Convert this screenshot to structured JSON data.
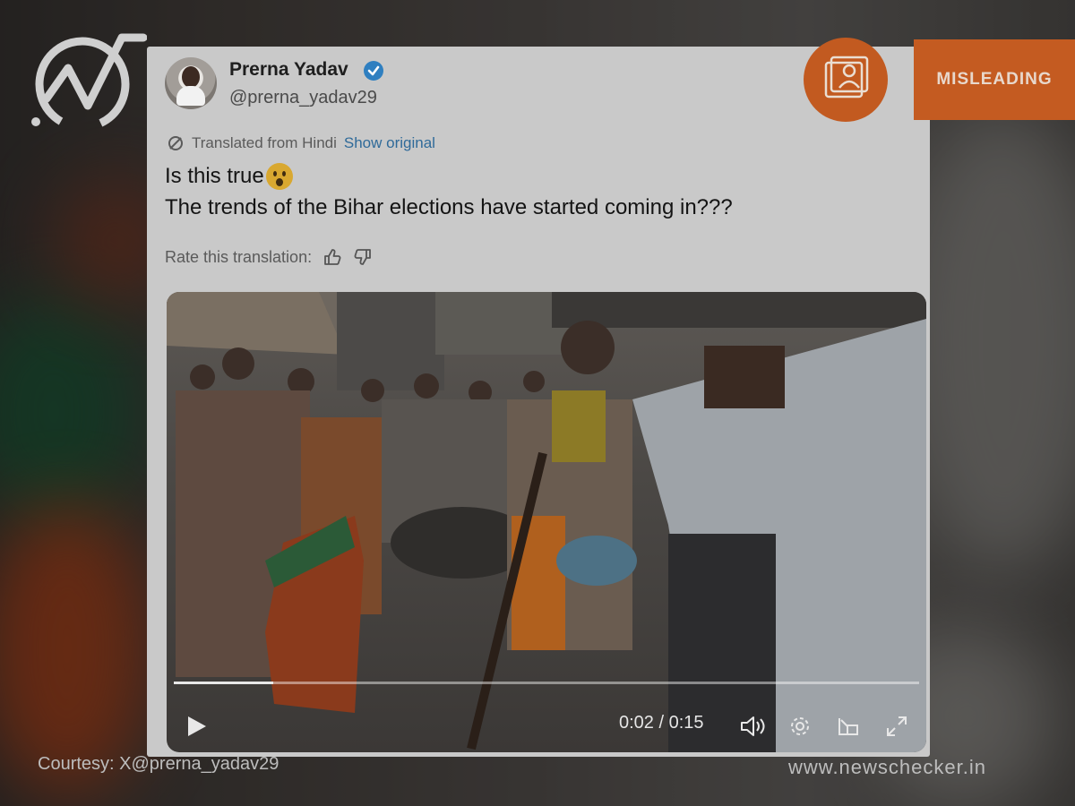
{
  "tweet": {
    "display_name": "Prerna Yadav",
    "handle": "@prerna_yadav29",
    "more_label": "·",
    "translated_label": "Translated from Hindi",
    "show_original_label": "Show original",
    "text_line1": "Is this true",
    "text_line2": "The trends of the Bihar elections have started coming in???",
    "rate_label": "Rate this translation:"
  },
  "video": {
    "current_time": "0:02",
    "duration": "0:15",
    "time_display": "0:02 / 0:15",
    "progress_fraction": 0.133
  },
  "stamp": {
    "label": "MISLEADING",
    "color": "#c45b21"
  },
  "footer": {
    "courtesy": "Courtesy:  X@prerna_yadav29",
    "site": "www.newschecker.in"
  },
  "colors": {
    "verified": "#2f7fc0",
    "link": "#2f6a99"
  }
}
